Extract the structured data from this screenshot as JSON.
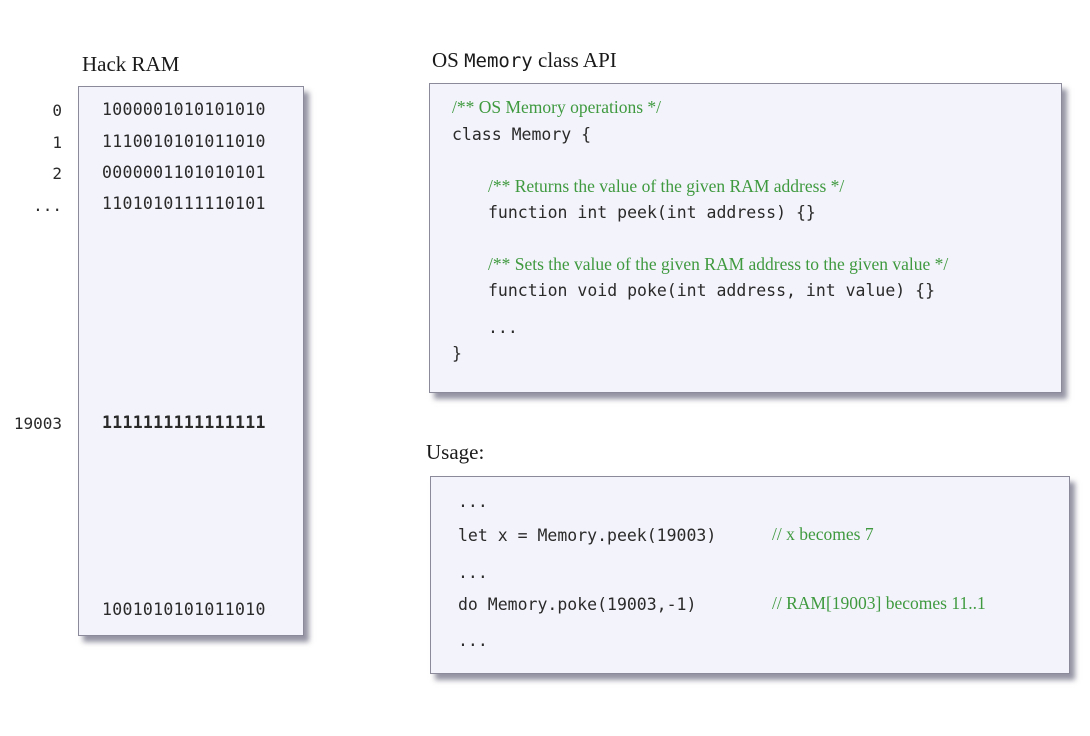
{
  "ram": {
    "title": "Hack RAM",
    "rows": [
      {
        "address": "0",
        "value": "1000001010101010"
      },
      {
        "address": "1",
        "value": "1110010101011010"
      },
      {
        "address": "2",
        "value": "0000001101010101"
      },
      {
        "address": "...",
        "value": "1101010111110101"
      },
      {
        "address": "19003",
        "value": "1111111111111111"
      },
      {
        "address": "",
        "value": "1001010101011010"
      }
    ]
  },
  "api": {
    "title_prefix": "OS ",
    "title_class": "Memory",
    "title_suffix": " class API",
    "header_comment": "/** OS Memory operations  */",
    "class_decl": "class Memory {",
    "peek_comment": "/** Returns the value of the given RAM address */",
    "peek_sig": "function int peek(int address) {}",
    "poke_comment": "/** Sets the value of the given RAM address to the given value */",
    "poke_sig": "function void poke(int address, int value) {}",
    "ellipsis": "...",
    "close_brace": "}"
  },
  "usage": {
    "title": "Usage:",
    "line1": "...",
    "line2_code": "let x = Memory.peek(19003)",
    "line2_comment": "// x becomes 7",
    "line3": "...",
    "line4_code": "do Memory.poke(19003,-1)",
    "line4_comment": "// RAM[19003] becomes 11..1",
    "line5": "..."
  }
}
